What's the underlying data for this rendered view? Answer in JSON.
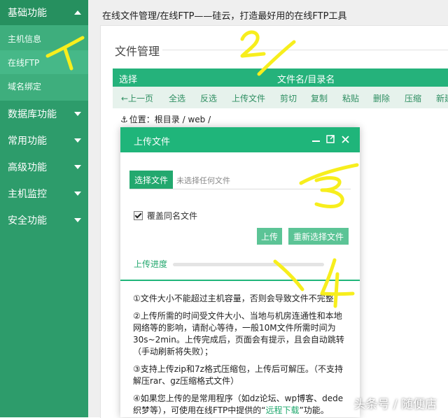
{
  "sidebar": {
    "sections": [
      {
        "label": "基础功能",
        "expanded": true
      },
      {
        "label": "数据库功能",
        "expanded": false
      },
      {
        "label": "常用功能",
        "expanded": false
      },
      {
        "label": "高级功能",
        "expanded": false
      },
      {
        "label": "主机监控",
        "expanded": false
      },
      {
        "label": "安全功能",
        "expanded": false
      }
    ],
    "basic_items": [
      "主机信息",
      "在线FTP",
      "域名绑定"
    ],
    "current_item": "在线FTP"
  },
  "header": {
    "title": "在线文件管理/在线FTP——硅云，打造最好用的在线FTP工具"
  },
  "file_manager": {
    "title": "文件管理",
    "columns": [
      "选择",
      "文件名/目录名"
    ],
    "toolbar": [
      "←上一页",
      "全选",
      "反选",
      "上传文件",
      "剪切",
      "复制",
      "粘贴",
      "删除",
      "压缩",
      "新建"
    ],
    "path_label": "位置：",
    "path_value": "根目录 / web /"
  },
  "upload_dialog": {
    "title": "上传文件",
    "choose_label": "选择文件",
    "no_file_text": "未选择任何文件",
    "overwrite_label": "覆盖同名文件",
    "overwrite_checked": true,
    "upload_label": "上传",
    "reselect_label": "重新选择文件",
    "progress_label": "上传进度",
    "progress_value": 0,
    "notes": [
      "①文件大小不能超过主机容量，否则会导致文件不完整",
      "②上传所需的时间受文件大小、当地与机房连通性和本地网络等的影响，请耐心等待，一般10M文件所需时间为30s~2min。上传完成后，页面会有提示，且会自动跳转（手动刷新将失败）；",
      "③支持上传zip和7z格式压缩包，上传后可解压。（不支持解压rar、gz压缩格式文件）"
    ],
    "note4_prefix": "④如果您上传的是常用程序（如dz论坛、wp博客、dede织梦等），可使用在线FTP中提供的“",
    "note4_link": "远程下载",
    "note4_suffix": "”功能。"
  },
  "annotations": [
    "1",
    "2",
    "3",
    "4"
  ],
  "watermark": "头条号 / 随便店",
  "colors": {
    "sidebar_bg": "#2d9c6b",
    "sidebar_sub_bg": "#3eae7d",
    "accent": "#1fb57a",
    "annotation_yellow": "#f7ee1d"
  }
}
